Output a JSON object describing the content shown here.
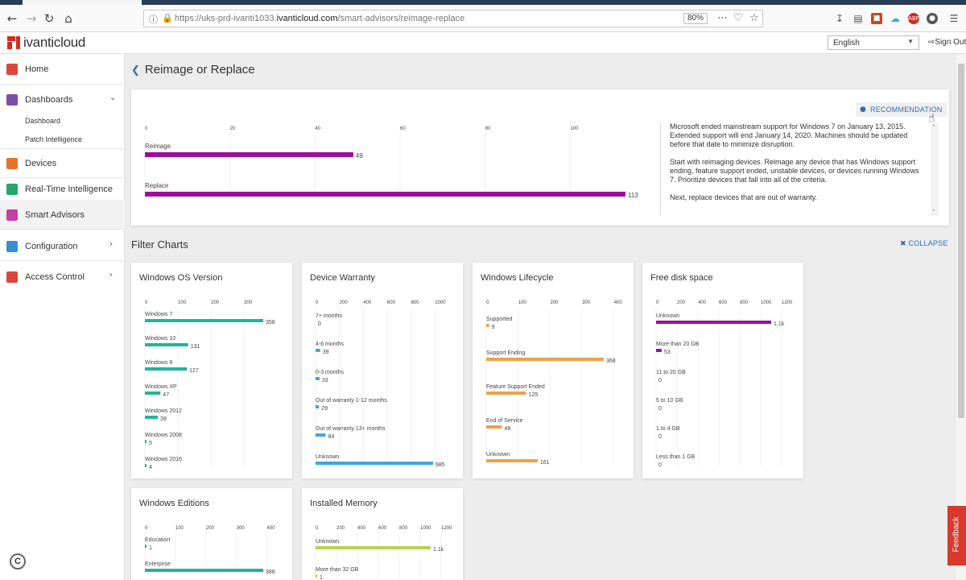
{
  "browser": {
    "url_prefix": "https://uks-prd-ivanti1033.",
    "url_domain": "ivanticloud.com",
    "url_path": "/smart-advisors/reimage-replace",
    "zoom": "80%"
  },
  "header": {
    "logo": "ivanticloud",
    "language": "English",
    "signout": "Sign Out"
  },
  "sidebar": {
    "home": "Home",
    "dashboards": "Dashboards",
    "dashboard": "Dashboard",
    "patch_intelligence": "Patch Intelligence",
    "devices": "Devices",
    "realtime": "Real-Time Intelligence",
    "smart_advisors": "Smart Advisors",
    "configuration": "Configuration",
    "access_control": "Access Control"
  },
  "page": {
    "title": "Reimage or Replace",
    "recommendation_button": "RECOMMENDATION",
    "recommendation_paragraphs": [
      "Microsoft ended mainstream support for Windows 7 on January 13, 2015. Extended support will end January 14, 2020. Machines should be updated before that date to minimize disruption.",
      "Start with reimaging devices. Reimage any device that has Windows support ending, feature support ended, unstable devices, or devices running Windows 7. Prioritize devices that fall into all of the criteria.",
      "Next, replace devices that are out of warranty."
    ],
    "filter_title": "Filter Charts",
    "collapse": "COLLAPSE",
    "feedback": "Feedback"
  },
  "colors": {
    "purple": "#9b0f9c",
    "teal": "#23b39b",
    "blue": "#3aa9df",
    "orange": "#eca14b",
    "lime": "#b6d34a",
    "accent": "#2d6fb3"
  },
  "chart_data": [
    {
      "id": "main",
      "type": "bar",
      "orientation": "horizontal",
      "ticks": [
        0,
        20,
        40,
        60,
        80,
        100
      ],
      "xlim": [
        0,
        113
      ],
      "color": "#9b0f9c",
      "categories": [
        "Reimage",
        "Replace"
      ],
      "values": [
        49,
        113
      ],
      "labels": [
        "49",
        "113"
      ]
    },
    {
      "id": "os",
      "title": "Windows OS Version",
      "type": "bar",
      "orientation": "horizontal",
      "ticks": [
        0,
        100,
        200,
        300
      ],
      "xlim": [
        0,
        358
      ],
      "color": "#23b39b",
      "categories": [
        "Windows 7",
        "Windows 10",
        "Windows 8",
        "Windows XP",
        "Windows 2012",
        "Windows 2008",
        "Windows 2016"
      ],
      "values": [
        358,
        131,
        127,
        47,
        39,
        5,
        4
      ],
      "labels": [
        "358",
        "131",
        "127",
        "47",
        "39",
        "5",
        "4"
      ]
    },
    {
      "id": "warranty",
      "title": "Device Warranty",
      "type": "bar",
      "orientation": "horizontal",
      "ticks": [
        0,
        200,
        400,
        600,
        800,
        1000
      ],
      "xlim": [
        0,
        985
      ],
      "color": "#3aa9df",
      "categories": [
        "7+ months",
        "4-6 months",
        "0-3 months",
        "Out of warranty 1-12 months",
        "Out of warranty 13+ months",
        "Unknown"
      ],
      "values": [
        0,
        39,
        33,
        29,
        84,
        985
      ],
      "labels": [
        "0",
        "39",
        "33",
        "29",
        "84",
        "985"
      ]
    },
    {
      "id": "lifecycle",
      "title": "Windows Lifecycle",
      "type": "bar",
      "orientation": "horizontal",
      "ticks": [
        0,
        100,
        200,
        300,
        400
      ],
      "xlim": [
        0,
        368
      ],
      "color": "#eca14b",
      "categories": [
        "Supported",
        "Support Ending",
        "Feature Support Ended",
        "End of Service",
        "Unknown"
      ],
      "values": [
        9,
        368,
        125,
        49,
        161
      ],
      "labels": [
        "9",
        "368",
        "125",
        "49",
        "161"
      ]
    },
    {
      "id": "disk",
      "title": "Free disk space",
      "type": "bar",
      "orientation": "horizontal",
      "ticks": [
        0,
        200,
        400,
        600,
        800,
        1000,
        1200
      ],
      "xlim": [
        0,
        1100
      ],
      "color": "#9b0f9c",
      "categories": [
        "Unknown",
        "More than 20 GB",
        "11 to 20 GB",
        "5 to 10 GB",
        "1 to 4 GB",
        "Less than 1 GB"
      ],
      "values": [
        1100,
        53,
        0,
        0,
        0,
        0
      ],
      "labels": [
        "1.1k",
        "53",
        "0",
        "0",
        "0",
        "0"
      ]
    },
    {
      "id": "editions",
      "title": "Windows Editions",
      "type": "bar",
      "orientation": "horizontal",
      "ticks": [
        0,
        100,
        200,
        300,
        400
      ],
      "xlim": [
        0,
        388
      ],
      "color": "#23b39b",
      "categories": [
        "Education",
        "Enterprise"
      ],
      "values": [
        1,
        388
      ],
      "labels": [
        "1",
        "388"
      ]
    },
    {
      "id": "memory",
      "title": "Installed Memory",
      "type": "bar",
      "orientation": "horizontal",
      "ticks": [
        0,
        200,
        400,
        600,
        800,
        1000,
        1200
      ],
      "xlim": [
        0,
        1100
      ],
      "color": "#b6d34a",
      "categories": [
        "Unknown",
        "More than 32 GB"
      ],
      "values": [
        1100,
        1
      ],
      "labels": [
        "1.1k",
        "1"
      ]
    }
  ]
}
